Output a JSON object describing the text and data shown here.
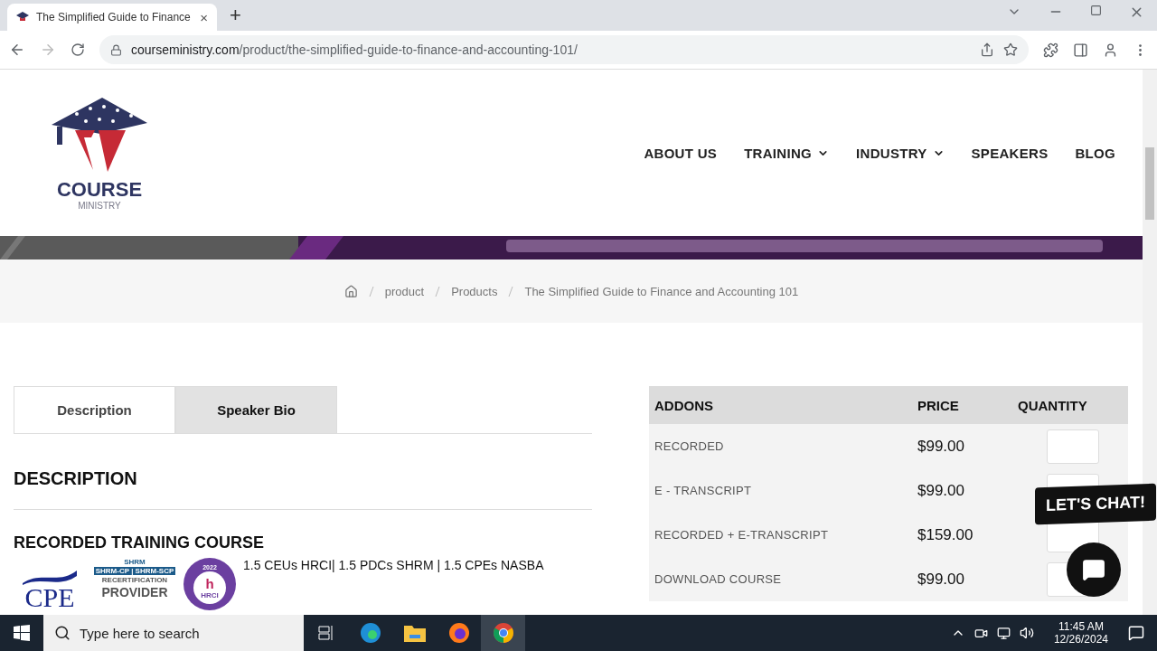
{
  "browser": {
    "tab_title": "The Simplified Guide to Finance",
    "tab_close": "×",
    "new_tab": "+",
    "url_host": "courseministry.com",
    "url_path": "/product/the-simplified-guide-to-finance-and-accounting-101/"
  },
  "logo": {
    "word": "COURSE",
    "sub": "MINISTRY"
  },
  "nav": [
    {
      "label": "ABOUT US",
      "dropdown": false
    },
    {
      "label": "TRAINING",
      "dropdown": true
    },
    {
      "label": "INDUSTRY",
      "dropdown": true
    },
    {
      "label": "SPEAKERS",
      "dropdown": false
    },
    {
      "label": "BLOG",
      "dropdown": false
    }
  ],
  "breadcrumb": [
    "product",
    "Products",
    "The Simplified Guide to Finance and Accounting 101"
  ],
  "tabs": [
    {
      "label": "Description",
      "selected": true
    },
    {
      "label": "Speaker Bio",
      "selected": false
    }
  ],
  "description": {
    "heading": "DESCRIPTION",
    "subheading": "RECORDED TRAINING COURSE",
    "credits": "1.5 CEUs HRCI| 1.5 PDCs SHRM | 1.5 CPEs NASBA",
    "badges": {
      "cpe": "CPE",
      "shrm": "SHRM",
      "shrm_levels": "SHRM-CP | SHRM-SCP",
      "recert": "RECERTIFICATION",
      "provider": "PROVIDER",
      "year": "2022",
      "hrci_mark": "h",
      "hrci": "HRCI"
    }
  },
  "addons": {
    "columns": [
      "ADDONS",
      "PRICE",
      "QUANTITY"
    ],
    "rows": [
      {
        "name": "RECORDED",
        "price": "$99.00"
      },
      {
        "name": "E - TRANSCRIPT",
        "price": "$99.00"
      },
      {
        "name": "RECORDED + E-TRANSCRIPT",
        "price": "$159.00"
      },
      {
        "name": "DOWNLOAD COURSE",
        "price": "$99.00"
      }
    ]
  },
  "chat": {
    "label": "LET'S CHAT!"
  },
  "taskbar": {
    "search_placeholder": "Type here to search",
    "time": "11:45 AM",
    "date": "12/26/2024"
  }
}
